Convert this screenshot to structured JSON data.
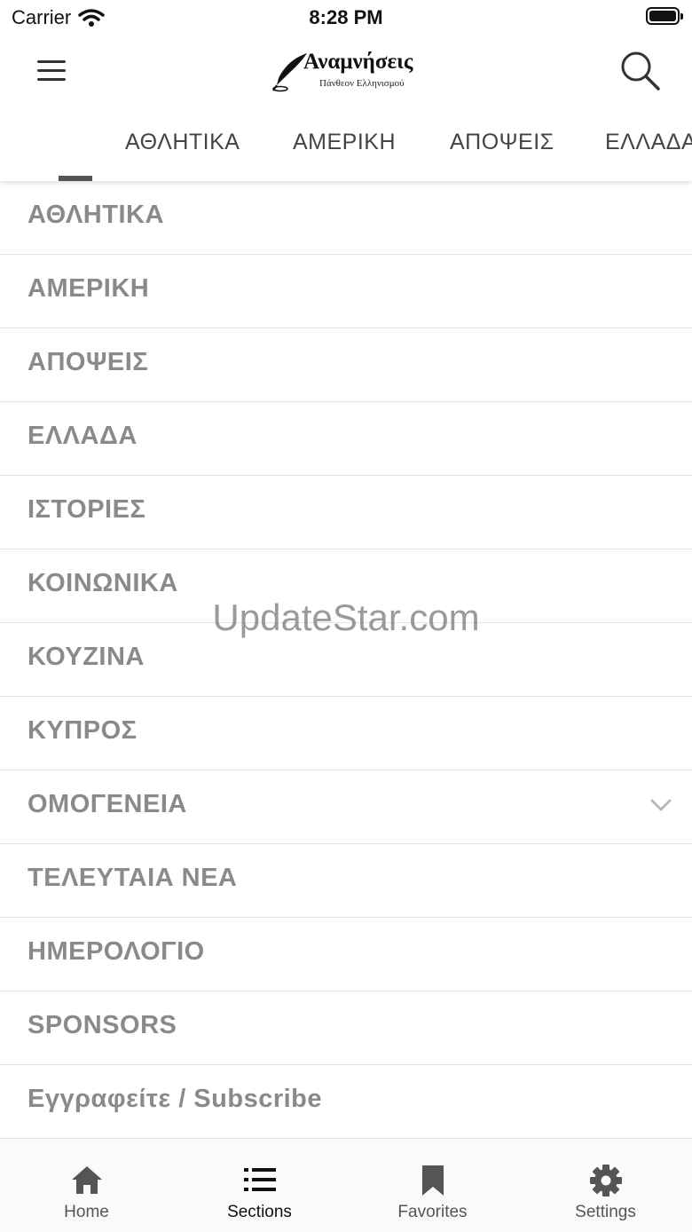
{
  "status_bar": {
    "carrier": "Carrier",
    "time": "8:28 PM"
  },
  "header": {
    "logo_title": "Αναμνήσεις",
    "logo_subtitle": "Πάνθεον Ελληνισμού",
    "menu_icon": "hamburger-icon",
    "search_icon": "search-icon"
  },
  "tabs": [
    {
      "label": "ΑΘΛΗΤΙΚΑ"
    },
    {
      "label": "ΑΜΕΡΙΚΗ"
    },
    {
      "label": "ΑΠΟΨΕΙΣ"
    },
    {
      "label": "ΕΛΛΑΔΑ"
    }
  ],
  "sections": [
    {
      "label": "ΑΘΛΗΤΙΚΑ"
    },
    {
      "label": "ΑΜΕΡΙΚΗ"
    },
    {
      "label": "ΑΠΟΨΕΙΣ"
    },
    {
      "label": "ΕΛΛΑΔΑ"
    },
    {
      "label": "ΙΣΤΟΡΙΕΣ"
    },
    {
      "label": "ΚΟΙΝΩΝΙΚΑ"
    },
    {
      "label": "ΚΟΥΖΙΝΑ"
    },
    {
      "label": "ΚΥΠΡΟΣ"
    },
    {
      "label": "ΟΜΟΓΕΝΕΙΑ",
      "expandable": true
    },
    {
      "label": "ΤΕΛΕΥΤΑΙΑ ΝΕΑ"
    },
    {
      "label": "ΗΜΕΡΟΛΟΓΙΟ"
    },
    {
      "label": "SPONSORS"
    },
    {
      "label": "Εγγραφείτε / Subscribe"
    }
  ],
  "watermark": "UpdateStar.com",
  "tabbar": [
    {
      "label": "Home",
      "icon": "home-icon"
    },
    {
      "label": "Sections",
      "icon": "list-icon",
      "active": true
    },
    {
      "label": "Favorites",
      "icon": "bookmark-icon"
    },
    {
      "label": "Settings",
      "icon": "gear-icon"
    }
  ],
  "colors": {
    "list_text": "#8a8a8a",
    "tab_text": "#444444",
    "active_tab_text": "#111111",
    "indicator": "#555555"
  }
}
